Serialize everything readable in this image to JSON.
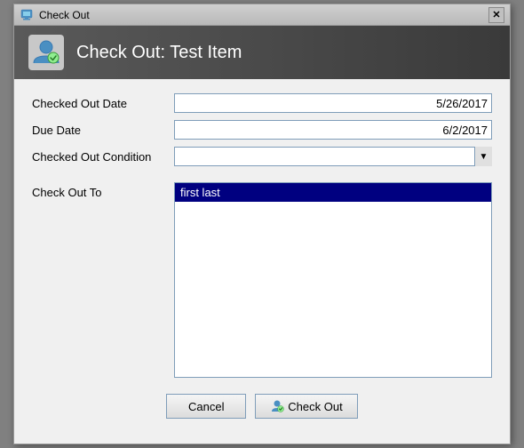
{
  "window": {
    "title": "Check Out",
    "close_label": "✕"
  },
  "header": {
    "title": "Check Out: Test Item"
  },
  "form": {
    "checked_out_date_label": "Checked Out Date",
    "checked_out_date_value": "5/26/2017",
    "due_date_label": "Due Date",
    "due_date_value": "6/2/2017",
    "checked_out_condition_label": "Checked Out Condition",
    "checked_out_condition_value": "",
    "check_out_to_label": "Check Out To",
    "check_out_to_selected": "first last"
  },
  "buttons": {
    "cancel_label": "Cancel",
    "checkout_label": "Check Out"
  }
}
